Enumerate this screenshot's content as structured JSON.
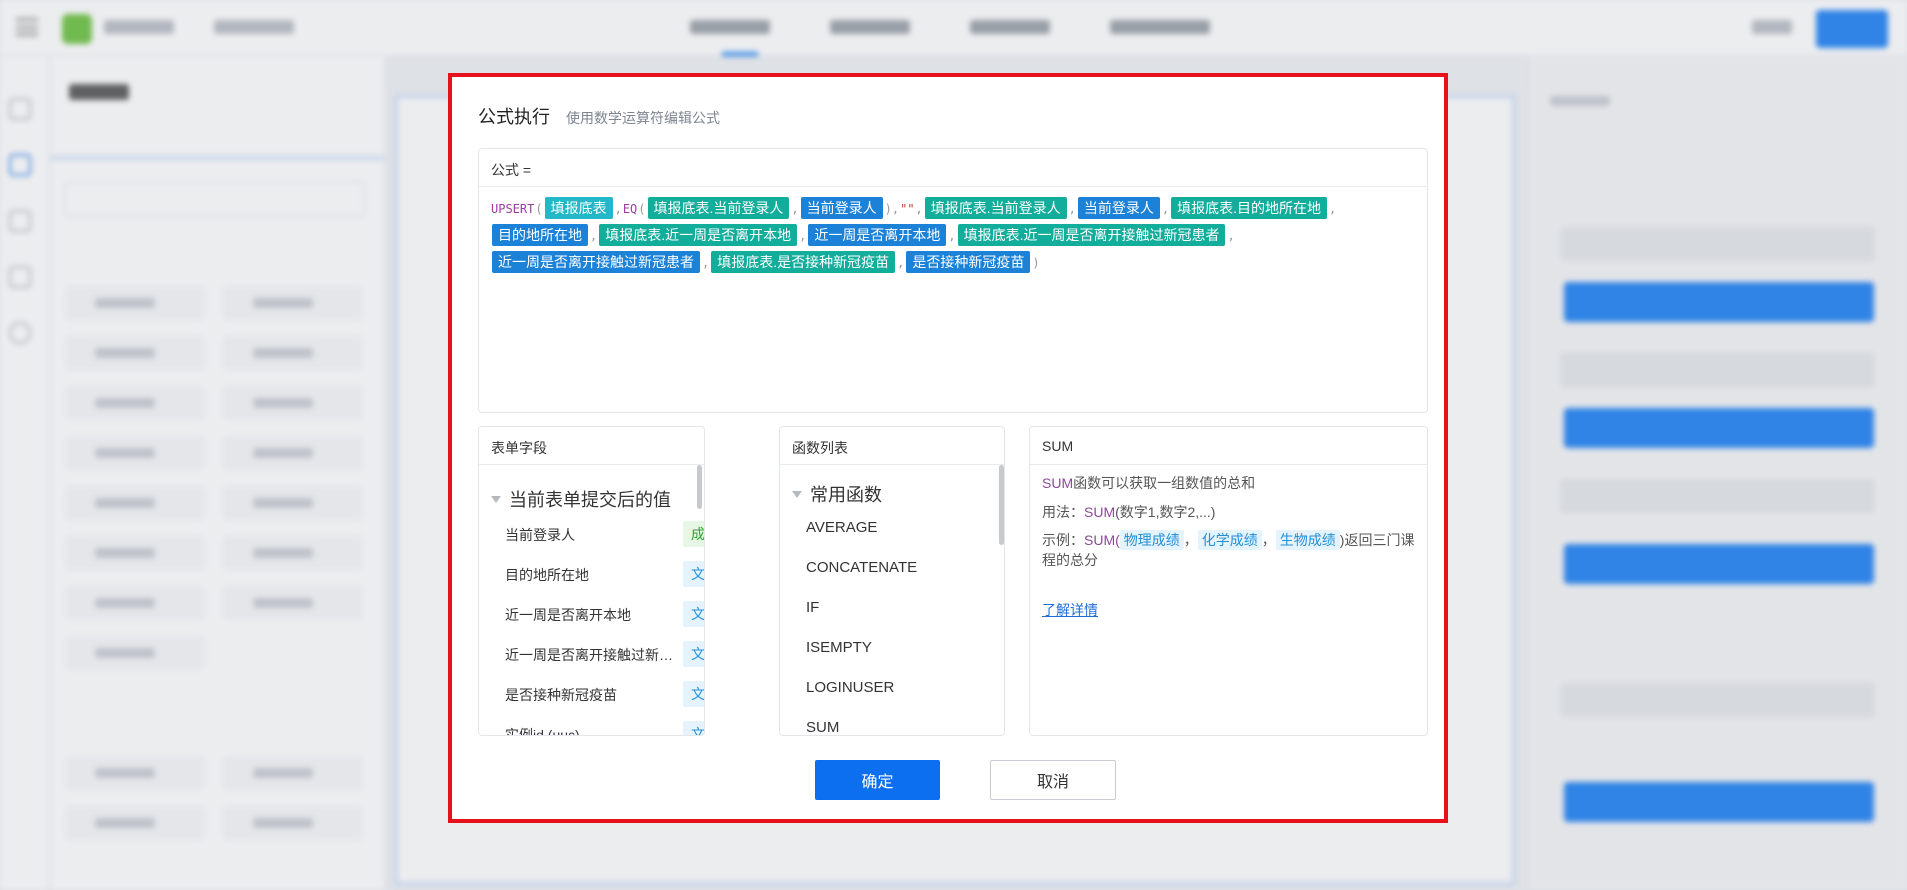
{
  "dialog": {
    "title": "公式执行",
    "subtitle": "使用数学运算符编辑公式",
    "formula_label": "公式 =",
    "formula": {
      "fn_upsert": "UPSERT",
      "fn_eq": "EQ",
      "empty_string": "\"\"",
      "tokens": {
        "t1": "填报底表",
        "t2": "填报底表.当前登录人",
        "t3": "当前登录人",
        "t4": "填报底表.当前登录人",
        "t5": "当前登录人",
        "t6": "填报底表.目的地所在地",
        "t7": "目的地所在地",
        "t8": "填报底表.近一周是否离开本地",
        "t9": "近一周是否离开本地",
        "t10": "填报底表.近一周是否离开接触过新冠患者",
        "t11": "近一周是否离开接触过新冠患者",
        "t12": "填报底表.是否接种新冠疫苗",
        "t13": "是否接种新冠疫苗"
      }
    },
    "fields_panel": {
      "title": "表单字段",
      "group": "当前表单提交后的值",
      "items": [
        {
          "name": "当前登录人",
          "type": "成员"
        },
        {
          "name": "目的地所在地",
          "type": "文本"
        },
        {
          "name": "近一周是否离开本地",
          "type": "文本"
        },
        {
          "name": "近一周是否离开接触过新…",
          "type": "文本"
        },
        {
          "name": "是否接种新冠疫苗",
          "type": "文本"
        },
        {
          "name": "实例id (uuc)",
          "type": "文本"
        }
      ]
    },
    "functions_panel": {
      "title": "函数列表",
      "group": "常用函数",
      "items": [
        "AVERAGE",
        "CONCATENATE",
        "IF",
        "ISEMPTY",
        "LOGINUSER",
        "SUM"
      ]
    },
    "doc_panel": {
      "title": "SUM",
      "desc_kw": "SUM",
      "desc_text": "函数可以获取一组数值的总和",
      "usage_label": "用法：",
      "usage_kw": "SUM",
      "usage_args": "(数字1,数字2,...)",
      "example_label": "示例：",
      "example_kw": "SUM(",
      "example_args": [
        "物理成绩",
        "化学成绩",
        "生物成绩"
      ],
      "example_tail": ")返回三门课程的总分",
      "link": "了解详情"
    },
    "confirm": "确定",
    "cancel": "取消"
  }
}
